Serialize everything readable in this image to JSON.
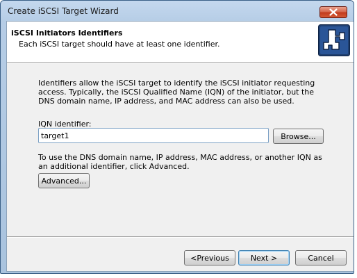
{
  "window": {
    "title": "Create iSCSI Target Wizard"
  },
  "header": {
    "title": "iSCSI Initiators Identifiers",
    "subtitle": "Each iSCSI target should have at least one identifier.",
    "icon": "wizard-puzzle-icon"
  },
  "body": {
    "description": "Identifiers allow the iSCSI target to identify the iSCSI initiator requesting access. Typically, the iSCSI Qualified Name (IQN) of the initiator, but the DNS domain name, IP address, and MAC address can also be used.",
    "iqn_label": "IQN identifier:",
    "iqn_value": "target1",
    "browse_label": "Browse...",
    "advanced_description": "To use the DNS domain name, IP address, MAC address, or another IQN as an additional identifier, click Advanced.",
    "advanced_label": "Advanced..."
  },
  "footer": {
    "previous_label": "<Previous",
    "next_label": "Next >",
    "cancel_label": "Cancel"
  },
  "colors": {
    "frame": "#b6cde6",
    "close_button": "#c23b1d",
    "dialog_background": "#f0f0f0"
  }
}
